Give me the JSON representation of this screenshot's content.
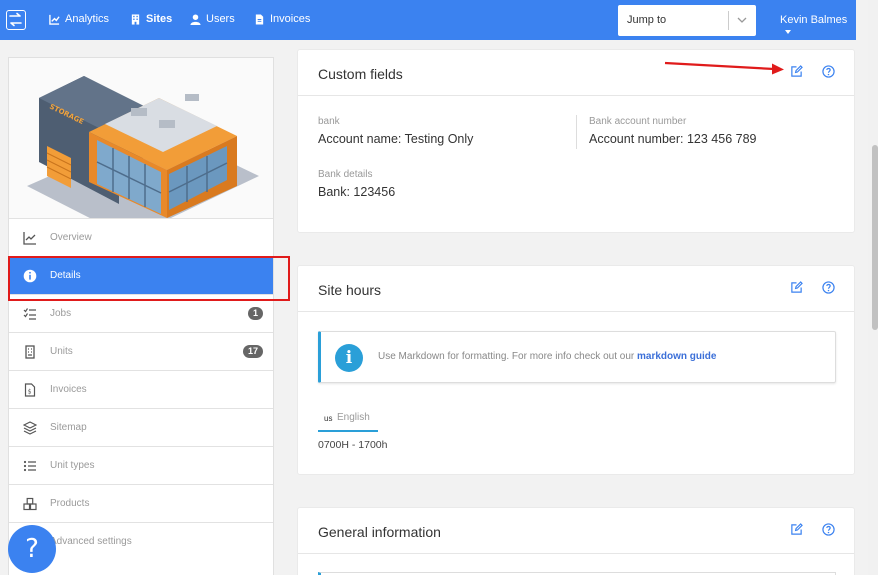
{
  "topbar": {
    "nav": [
      {
        "label": "Analytics",
        "icon": "chart-icon"
      },
      {
        "label": "Sites",
        "icon": "building-icon"
      },
      {
        "label": "Users",
        "icon": "user-icon"
      },
      {
        "label": "Invoices",
        "icon": "file-icon"
      }
    ],
    "jump_placeholder": "Jump to",
    "user_name": "Kevin Balmes"
  },
  "sidebar": {
    "building_sign": "STORAGE",
    "items": [
      {
        "label": "Overview",
        "icon": "trend-icon"
      },
      {
        "label": "Details",
        "icon": "info-icon",
        "active": true
      },
      {
        "label": "Jobs",
        "icon": "checklist-icon",
        "badge": "1"
      },
      {
        "label": "Units",
        "icon": "units-icon",
        "badge": "17"
      },
      {
        "label": "Invoices",
        "icon": "invoice-icon"
      },
      {
        "label": "Sitemap",
        "icon": "layers-icon"
      },
      {
        "label": "Unit types",
        "icon": "list-icon"
      },
      {
        "label": "Products",
        "icon": "boxes-icon"
      },
      {
        "label": "Advanced settings",
        "icon": "gear-icon"
      }
    ],
    "help_label": "?"
  },
  "custom_fields": {
    "title": "Custom fields",
    "fields": [
      {
        "label": "bank",
        "value": "Account name: Testing Only"
      },
      {
        "label": "Bank account number",
        "value": "Account number: 123 456 789"
      },
      {
        "label": "Bank details",
        "value": "Bank: 123456"
      }
    ]
  },
  "site_hours": {
    "title": "Site hours",
    "info_text": "Use Markdown for formatting.  For more info check out our ",
    "info_link": "markdown guide",
    "lang_code": "us",
    "lang_name": "English",
    "hours": "0700H - 1700h"
  },
  "general_info": {
    "title": "General information"
  },
  "colors": {
    "primary": "#3b82f0",
    "info": "#2a9fd8",
    "annotation": "#e01b1b"
  }
}
